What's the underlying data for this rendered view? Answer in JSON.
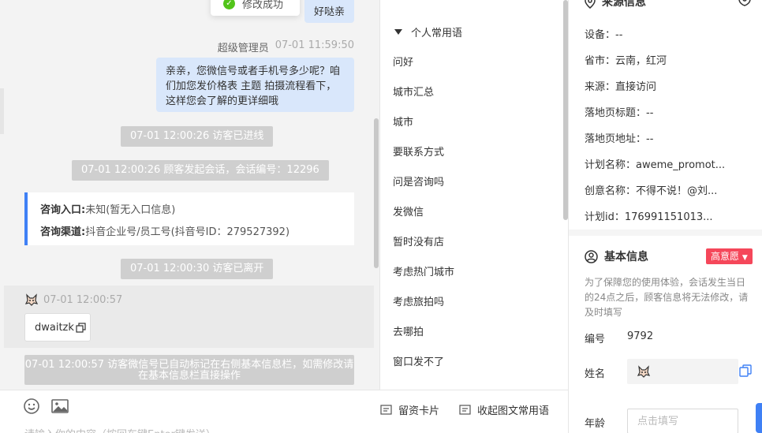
{
  "toast": {
    "icon": "check-circle-icon",
    "text": "修改成功"
  },
  "chat": {
    "prev_bubble": "好哒亲",
    "agent_message": {
      "sender": "超级管理员",
      "time": "07-01 11:59:50",
      "text": "亲亲，您微信号或者手机号多少呢？咱们加您发价格表 主题 拍摄流程看下，这样您会了解的更详细哦"
    },
    "system_entered": "07-01 12:00:26 访客已进线",
    "system_session": "07-01 12:00:26 顾客发起会话，会话编号：12296",
    "info_card": {
      "entry_label": "咨询入口:",
      "entry_value": "未知(暂无入口信息)",
      "channel_label": "咨询渠道:",
      "channel_value": "抖音企业号/员工号(抖音号ID：279527392)"
    },
    "system_left": "07-01 12:00:30 访客已离开",
    "visitor_message": {
      "time": "07-01 12:00:57",
      "avatar_icon": "visitor-avatar-icon",
      "wechat": "dwaitzk",
      "copy_icon": "copy-icon"
    },
    "system_autotag": "07-01 12:00:57 访客微信号已自动标记在右侧基本信息栏，如需修改请在基本信息栏直接操作"
  },
  "input_bar": {
    "emoji_icon": "emoji-icon",
    "image_icon": "image-icon",
    "card_button": "留资卡片",
    "collapse_button": "收起图文常用语",
    "placeholder": "请输入你的内容（按回车键Enter键发送）"
  },
  "phrases": {
    "header": "个人常用语",
    "items": [
      "问好",
      "城市汇总",
      "城市",
      "要联系方式",
      "问是咨询吗",
      "发微信",
      "暂时没有店",
      "考虑热门城市",
      "考虑旅拍吗",
      "去哪拍",
      "窗口发不了"
    ]
  },
  "info": {
    "source_title": "来源信息",
    "source_rows": [
      {
        "label": "设备：",
        "value": "--"
      },
      {
        "label": "省市：",
        "value": "云南，红河"
      },
      {
        "label": "来源：",
        "value": "直接访问"
      },
      {
        "label": "落地页标题：",
        "value": "--"
      },
      {
        "label": "落地页地址：",
        "value": "--"
      },
      {
        "label": "计划名称：",
        "value": "aweme_promot..."
      },
      {
        "label": "创意名称：",
        "value": "不得不说！@刘..."
      },
      {
        "label": "计划id：",
        "value": "176991151013..."
      }
    ],
    "basic_title": "基本信息",
    "intent_badge": "高意愿",
    "notice": "为了保障您的使用体验，会话发生当日的24点之后，顾客信息将无法修改，请及时填写",
    "id_label": "编号",
    "id_value": "9792",
    "name_label": "姓名",
    "age_label": "年龄",
    "age_placeholder": "点击填写"
  }
}
